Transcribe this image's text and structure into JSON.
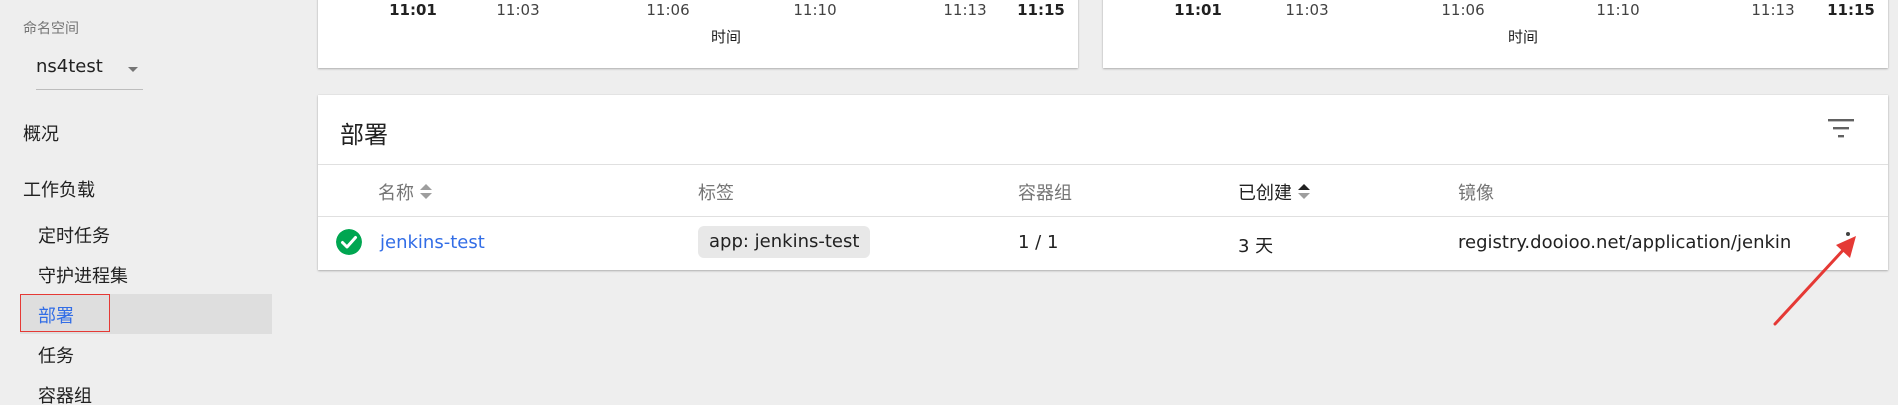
{
  "sidebar": {
    "namespace_label": "命名空间",
    "namespace_value": "ns4test",
    "overview": "概况",
    "workloads": "工作负载",
    "items": [
      {
        "label": "定时任务"
      },
      {
        "label": "守护进程集"
      },
      {
        "label": "部署"
      },
      {
        "label": "任务"
      },
      {
        "label": "容器组"
      }
    ]
  },
  "charts": [
    {
      "ticks": [
        "11:01",
        "11:03",
        "11:06",
        "11:10",
        "11:13",
        "11:15"
      ],
      "axis_title": "时间"
    },
    {
      "ticks": [
        "11:01",
        "11:03",
        "11:06",
        "11:10",
        "11:13",
        "11:15"
      ],
      "axis_title": "时间"
    }
  ],
  "deployments": {
    "title": "部署",
    "columns": {
      "name": "名称",
      "labels": "标签",
      "pods": "容器组",
      "created": "已创建",
      "images": "镜像"
    },
    "rows": [
      {
        "status": "running",
        "name": "jenkins-test",
        "label": "app: jenkins-test",
        "pods": "1 / 1",
        "created": "3 天",
        "image": "registry.dooioo.net/application/jenkin"
      }
    ]
  },
  "colors": {
    "accent": "#326de6",
    "success": "#00a651",
    "annotation": "#e53935"
  },
  "icons": {
    "filter": "filter-icon",
    "status": "check-circle-icon",
    "menu": "more-vert-icon"
  }
}
